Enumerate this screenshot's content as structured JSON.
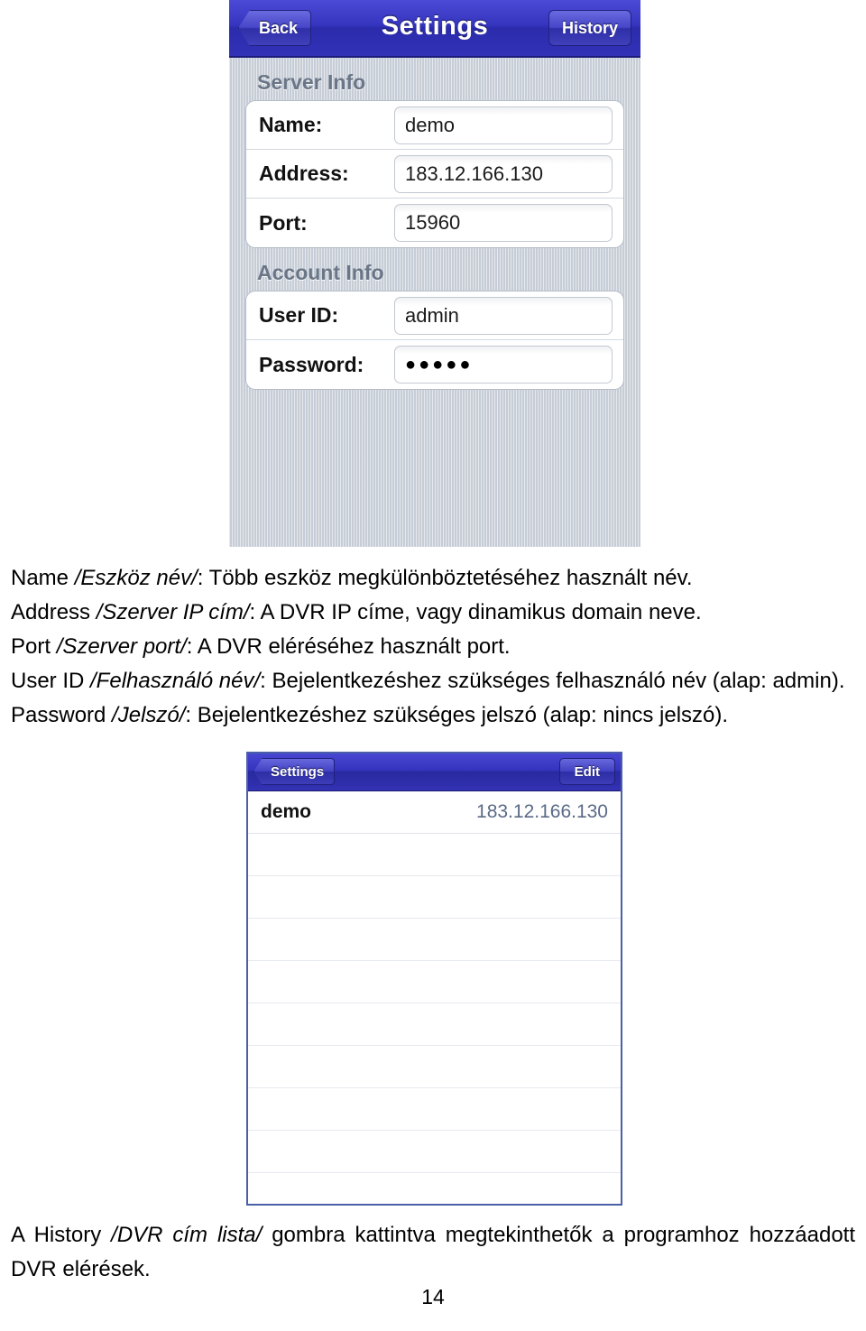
{
  "screenshot_settings": {
    "navbar": {
      "back_label": "Back",
      "title": "Settings",
      "history_label": "History"
    },
    "sections": [
      {
        "header": "Server Info",
        "rows": [
          {
            "label": "Name:",
            "value": "demo"
          },
          {
            "label": "Address:",
            "value": "183.12.166.130"
          },
          {
            "label": "Port:",
            "value": "15960"
          }
        ]
      },
      {
        "header": "Account Info",
        "rows": [
          {
            "label": "User ID:",
            "value": "admin"
          },
          {
            "label": "Password:",
            "value": "●●●●●"
          }
        ]
      }
    ]
  },
  "body_text": {
    "p1_a": "Name ",
    "p1_b": "/Eszköz név/",
    "p1_c": ": Több eszköz megkülönböztetéséhez használt név.",
    "p2_a": "Address ",
    "p2_b": "/Szerver IP cím/",
    "p2_c": ": A DVR IP címe, vagy dinamikus domain neve.",
    "p3_a": "Port ",
    "p3_b": "/Szerver port/",
    "p3_c": ": A DVR eléréséhez használt port.",
    "p4_a": "User ID ",
    "p4_b": "/Felhasználó név/",
    "p4_c": ": Bejelentkezéshez szükséges felhasználó név (alap: admin).",
    "p5_a": "Password ",
    "p5_b": "/Jelszó/",
    "p5_c": ": Bejelentkezéshez szükséges jelszó (alap: nincs jelszó).",
    "p6_a": "A History ",
    "p6_b": "/DVR cím lista/",
    "p6_c": " gombra kattintva megtekinthetők a programhoz hozzáadott DVR elérések."
  },
  "screenshot_list": {
    "navbar": {
      "settings_label": "Settings",
      "edit_label": "Edit"
    },
    "items": [
      {
        "name": "demo",
        "address": "183.12.166.130"
      }
    ],
    "empty_row_count": 8
  },
  "page_number": "14",
  "colors": {
    "nav_blue": "#3434bf",
    "section_header_gray": "#6a7687",
    "list_border_blue": "#4a5fa8",
    "address_text": "#5a6a86"
  }
}
